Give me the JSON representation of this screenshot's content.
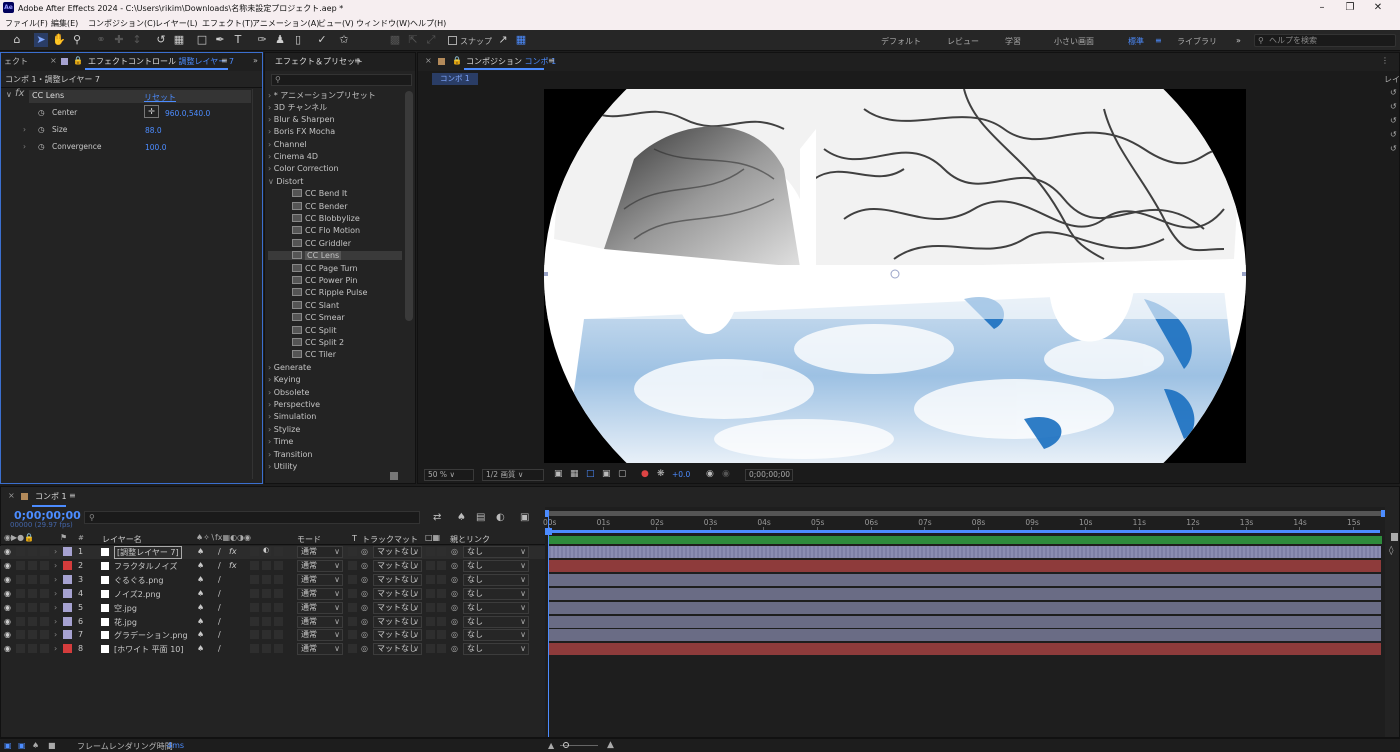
{
  "app": {
    "title": "Adobe After Effects 2024 - C:\\Users\\rikim\\Downloads\\名称未設定プロジェクト.aep *",
    "logo": "Ae"
  },
  "menu": [
    "ファイル(F)",
    "編集(E)",
    "コンポジション(C)",
    "レイヤー(L)",
    "エフェクト(T)",
    "アニメーション(A)",
    "ビュー(V)",
    "ウィンドウ(W)",
    "ヘルプ(H)"
  ],
  "toolbar": {
    "snap_label": "スナップ",
    "workspaces": [
      "デフォルト",
      "レビュー",
      "学習",
      "小さい画面",
      "標準",
      "ライブラリ"
    ],
    "active_workspace": "標準",
    "help_placeholder": "ヘルプを検索"
  },
  "effect_controls": {
    "tab_left": "ェクト",
    "tab_label": "エフェクトコントロール",
    "tab_layer": "調整レイヤー 7",
    "breadcrumb": "コンポ 1・調整レイヤー 7",
    "effect_name": "CC Lens",
    "reset_label": "リセット",
    "props": [
      {
        "name": "Center",
        "value": "960.0,540.0"
      },
      {
        "name": "Size",
        "value": "88.0"
      },
      {
        "name": "Convergence",
        "value": "100.0"
      }
    ]
  },
  "effects_presets": {
    "tab_label": "エフェクト＆プリセット",
    "categories_top": [
      "* アニメーションプリセット",
      "3D チャンネル",
      "Blur & Sharpen",
      "Boris FX Mocha",
      "Channel",
      "Cinema 4D",
      "Color Correction",
      "Distort"
    ],
    "distort_items": [
      "CC Bend It",
      "CC Bender",
      "CC Blobbylize",
      "CC Flo Motion",
      "CC Griddler",
      "CC Lens",
      "CC Page Turn",
      "CC Power Pin",
      "CC Ripple Pulse",
      "CC Slant",
      "CC Smear",
      "CC Split",
      "CC Split 2",
      "CC Tiler"
    ],
    "selected_item": "CC Lens",
    "categories_bottom": [
      "Generate",
      "Keying",
      "Obsolete",
      "Perspective",
      "Simulation",
      "Stylize",
      "Time",
      "Transition",
      "Utility"
    ]
  },
  "composition": {
    "tab_prefix": "コンポジション",
    "tab_name": "コンポ 1",
    "subtab": "コンポ 1",
    "zoom": "50 %",
    "resolution": "1/2 画質",
    "exposure": "+0.0",
    "timecode": "0;00;00;00"
  },
  "timeline": {
    "tab_name": "コンポ 1",
    "timecode": "0;00;00;00",
    "fps": "00000 (29.97 fps)",
    "col_layer_name": "レイヤー名",
    "col_mode": "モード",
    "col_trackmatte": "トラックマット",
    "col_parent": "親とリンク",
    "ruler": [
      "00s",
      "01s",
      "02s",
      "03s",
      "04s",
      "05s",
      "06s",
      "07s",
      "08s",
      "09s",
      "10s",
      "11s",
      "12s",
      "13s",
      "14s",
      "15s"
    ],
    "layers": [
      {
        "num": "1",
        "name": "[調整レイヤー 7]",
        "mode": "通常",
        "matte": "マットなし",
        "parent": "なし",
        "label_color": "#a6a2d1",
        "bar_color": "#7d7fa6",
        "fx": true
      },
      {
        "num": "2",
        "name": "フラクタルノイズ",
        "mode": "通常",
        "matte": "マットなし",
        "parent": "なし",
        "label_color": "#d43c3c",
        "bar_color": "#8e3b3b",
        "fx": true
      },
      {
        "num": "3",
        "name": "ぐるぐる.png",
        "mode": "通常",
        "matte": "マットなし",
        "parent": "なし",
        "label_color": "#a6a2d1",
        "bar_color": "#6a6c85",
        "fx": false
      },
      {
        "num": "4",
        "name": "ノイズ2.png",
        "mode": "通常",
        "matte": "マットなし",
        "parent": "なし",
        "label_color": "#a6a2d1",
        "bar_color": "#6a6c85",
        "fx": false
      },
      {
        "num": "5",
        "name": "空.jpg",
        "mode": "通常",
        "matte": "マットなし",
        "parent": "なし",
        "label_color": "#a6a2d1",
        "bar_color": "#6a6c85",
        "fx": false
      },
      {
        "num": "6",
        "name": "花.jpg",
        "mode": "通常",
        "matte": "マットなし",
        "parent": "なし",
        "label_color": "#a6a2d1",
        "bar_color": "#6a6c85",
        "fx": false
      },
      {
        "num": "7",
        "name": "グラデーション.png",
        "mode": "通常",
        "matte": "マットなし",
        "parent": "なし",
        "label_color": "#a6a2d1",
        "bar_color": "#6a6c85",
        "fx": false
      },
      {
        "num": "8",
        "name": "[ホワイト 平面 10]",
        "mode": "通常",
        "matte": "マットなし",
        "parent": "なし",
        "label_color": "#d43c3c",
        "bar_color": "#8e3b3b",
        "fx": false
      }
    ]
  },
  "statusbar": {
    "label": "フレームレンダリング時間",
    "value": "4ms"
  }
}
